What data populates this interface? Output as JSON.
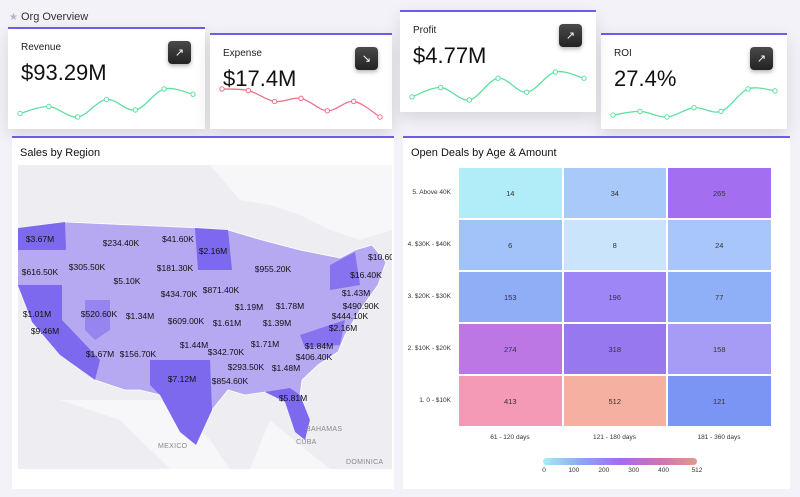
{
  "header": {
    "title": "Org Overview",
    "icon": "star-icon"
  },
  "kpis": [
    {
      "label": "Revenue",
      "value": "$93.29M",
      "trend": "up",
      "icon": "arrow-up-right-icon",
      "color": "#5ee0a0",
      "spark": [
        3,
        5,
        2,
        7,
        4,
        10,
        8.5
      ]
    },
    {
      "label": "Expense",
      "value": "$17.4M",
      "trend": "down",
      "icon": "arrow-down-right-icon",
      "color": "#f07088",
      "spark": [
        10,
        9.5,
        6,
        7,
        3,
        6,
        1
      ]
    },
    {
      "label": "Profit",
      "value": "$4.77M",
      "trend": "up",
      "icon": "arrow-up-right-icon",
      "color": "#5ee0a0",
      "spark": [
        2,
        5,
        1,
        8,
        3.5,
        10,
        8
      ]
    },
    {
      "label": "ROI",
      "value": "27.4%",
      "trend": "up",
      "icon": "arrow-up-right-icon",
      "color": "#5ee0a0",
      "spark": [
        1,
        2,
        0.5,
        3,
        2,
        8,
        7.5
      ]
    }
  ],
  "map": {
    "title": "Sales by Region",
    "geo_labels": [
      "MEXICO",
      "BAHAMAS",
      "CUBA",
      "DOMINICA"
    ],
    "labels": [
      "$3.67M",
      "$234.40K",
      "$41.60K",
      "$2.16M",
      "$616.50K",
      "$305.50K",
      "$181.30K",
      "$955.20K",
      "$10.60",
      "$16.40K",
      "$5.10K",
      "$434.70K",
      "$871.40K",
      "$1.43M",
      "$1.01M",
      "$520.60K",
      "$1.34M",
      "$609.00K",
      "$1.78M",
      "$490.90K",
      "$444.10K",
      "$1.19M",
      "$1.61M",
      "$1.39M",
      "$9.46M",
      "$2.16M",
      "$1.44M",
      "$1.71M",
      "$1.84M",
      "$342.70K",
      "$406.40K",
      "$1.67M",
      "$156.70K",
      "$293.50K",
      "$1.48M",
      "$7.12M",
      "$854.60K",
      "$5.81M"
    ]
  },
  "chart_data": {
    "type": "heatmap",
    "title": "Open Deals by Age & Amount",
    "rows": [
      "5. Above 40K",
      "4. $30K - $40K",
      "3. $20K - $30K",
      "2. $10K - $20K",
      "1. 0 - $10K"
    ],
    "columns": [
      "61 - 120 days",
      "121 - 180 days",
      "181 - 360 days"
    ],
    "values": [
      [
        14,
        34,
        265
      ],
      [
        6,
        8,
        24
      ],
      [
        153,
        196,
        77
      ],
      [
        274,
        318,
        158
      ],
      [
        413,
        512,
        121
      ]
    ],
    "colors": [
      [
        "#b1edf9",
        "#a9c9fa",
        "#a46ef0"
      ],
      [
        "#a1c3fa",
        "#c9e4fb",
        "#a8c6fa"
      ],
      [
        "#90aef5",
        "#9f86f6",
        "#8fb0f6"
      ],
      [
        "#bc77e5",
        "#9778ee",
        "#a79cf5"
      ],
      [
        "#f59ab6",
        "#f6b0a1",
        "#7b95f5"
      ]
    ],
    "legend": {
      "min": 0,
      "max": 512,
      "ticks": [
        "0",
        "100",
        "200",
        "300",
        "400",
        "512"
      ]
    }
  }
}
